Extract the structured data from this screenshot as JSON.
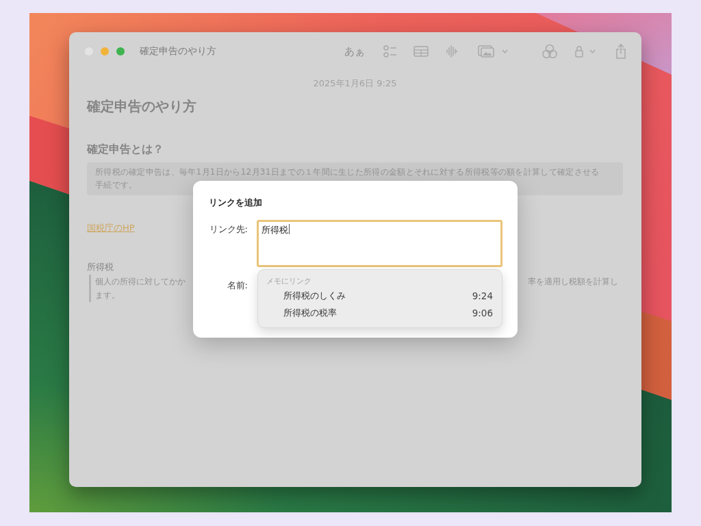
{
  "window": {
    "title": "確定申告のやり方",
    "controls": [
      {
        "kind": "close",
        "disabled": true
      },
      {
        "kind": "minimize",
        "disabled": false
      },
      {
        "kind": "zoom",
        "disabled": false
      }
    ]
  },
  "toolbar": {
    "format_label": "あぁ"
  },
  "note": {
    "date": "2025年1月6日 9:25",
    "title": "確定申告のやり方",
    "heading": "確定申告とは？",
    "block_text": "所得税の確定申告は、毎年1月1日から12月31日までの１年間に生じた所得の金額とそれに対する所得税等の額を計算して確定させる手続です。",
    "link": "国税庁のHP",
    "subheading": "所得税",
    "quote": {
      "line_1_start": "個人の所得に対してかか",
      "line_1_end": "率を適用し税額を計算し",
      "line_2": "ます。"
    }
  },
  "dialog": {
    "title": "リンクを追加",
    "link_field": {
      "label": "リンク先:",
      "value": "所得税",
      "focused": true
    },
    "name_label": "名前:",
    "suggestions": {
      "header": "メモにリンク",
      "items": [
        {
          "title": "所得税のしくみ",
          "time": "9:24"
        },
        {
          "title": "所得税の税率",
          "time": "9:06"
        }
      ]
    }
  }
}
